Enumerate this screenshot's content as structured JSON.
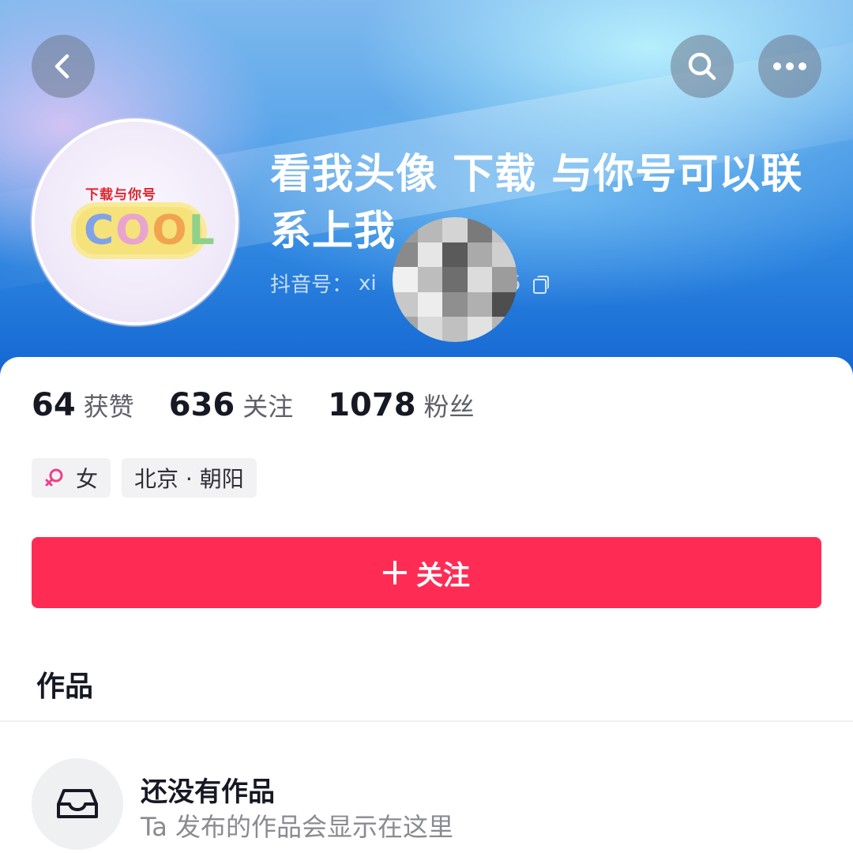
{
  "header": {
    "nickname": "看我头像 下载 与你号可以联系上我",
    "handle_label": "抖音号：",
    "handle_value_visible_start": "xi",
    "handle_value_visible_end": "6"
  },
  "avatar": {
    "caption": "下载与你号",
    "logo_text": [
      "C",
      "O",
      "O",
      "L"
    ]
  },
  "icons": {
    "back": "chevron-left-icon",
    "search": "search-icon",
    "more": "more-dots-icon",
    "copy": "copy-icon",
    "female": "female-icon",
    "plus": "plus-icon",
    "empty": "inbox-icon"
  },
  "stats": [
    {
      "value": "64",
      "label": "获赞"
    },
    {
      "value": "636",
      "label": "关注"
    },
    {
      "value": "1078",
      "label": "粉丝"
    }
  ],
  "tags": {
    "gender": "女",
    "location": "北京 · 朝阳"
  },
  "follow_button": {
    "label": "关注",
    "color": "#fe2c55"
  },
  "works": {
    "title": "作品",
    "empty_title": "还没有作品",
    "empty_desc": "Ta 发布的作品会显示在这里"
  }
}
